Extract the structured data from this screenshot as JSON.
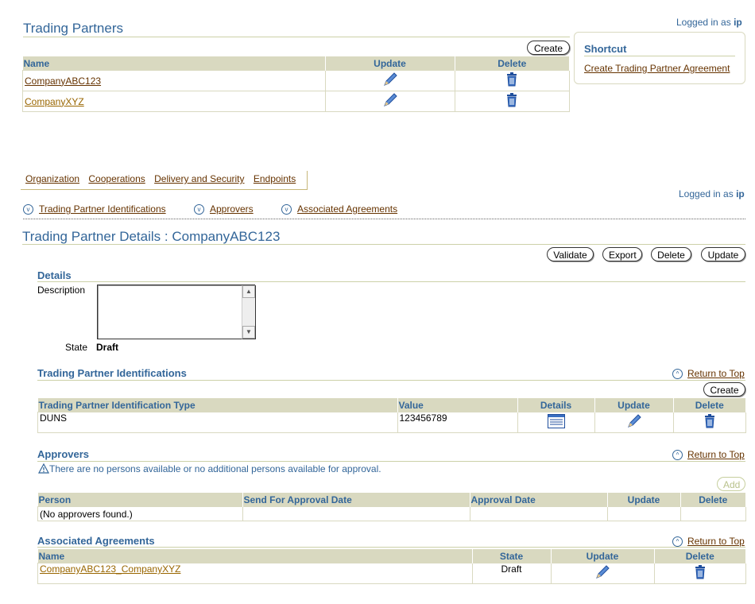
{
  "header": {
    "logged_in_prefix": "Logged in as",
    "user": "ip"
  },
  "partners": {
    "title": "Trading Partners",
    "create_label": "Create",
    "columns": [
      "Name",
      "Update",
      "Delete"
    ],
    "rows": [
      {
        "name": "CompanyABC123"
      },
      {
        "name": "CompanyXYZ"
      }
    ]
  },
  "shortcut": {
    "title": "Shortcut",
    "link": "Create Trading Partner Agreement"
  },
  "tabs": [
    "Organization",
    "Cooperations",
    "Delivery and Security",
    "Endpoints"
  ],
  "logged_in2": {
    "prefix": "Logged in as",
    "user": "ip"
  },
  "anchors": [
    "Trading Partner Identifications",
    "Approvers",
    "Associated Agreements"
  ],
  "details_page": {
    "title": "Trading Partner Details : CompanyABC123",
    "buttons": [
      "Validate",
      "Export",
      "Delete",
      "Update"
    ],
    "section_title": "Details",
    "description_label": "Description",
    "description_value": "",
    "state_label": "State",
    "state_value": "Draft"
  },
  "identifications": {
    "title": "Trading Partner Identifications",
    "return_label": "Return to Top",
    "create_label": "Create",
    "columns": [
      "Trading Partner Identification Type",
      "Value",
      "Details",
      "Update",
      "Delete"
    ],
    "rows": [
      {
        "type": "DUNS",
        "value": "123456789"
      }
    ]
  },
  "approvers": {
    "title": "Approvers",
    "return_label": "Return to Top",
    "warning": "There are no persons available or no additional persons available for approval.",
    "add_label": "Add",
    "columns": [
      "Person",
      "Send For Approval Date",
      "Approval Date",
      "Update",
      "Delete"
    ],
    "empty": "(No approvers found.)"
  },
  "agreements": {
    "title": "Associated Agreements",
    "return_label": "Return to Top",
    "columns": [
      "Name",
      "State",
      "Update",
      "Delete"
    ],
    "rows": [
      {
        "name": "CompanyABC123_CompanyXYZ",
        "state": "Draft"
      }
    ]
  }
}
